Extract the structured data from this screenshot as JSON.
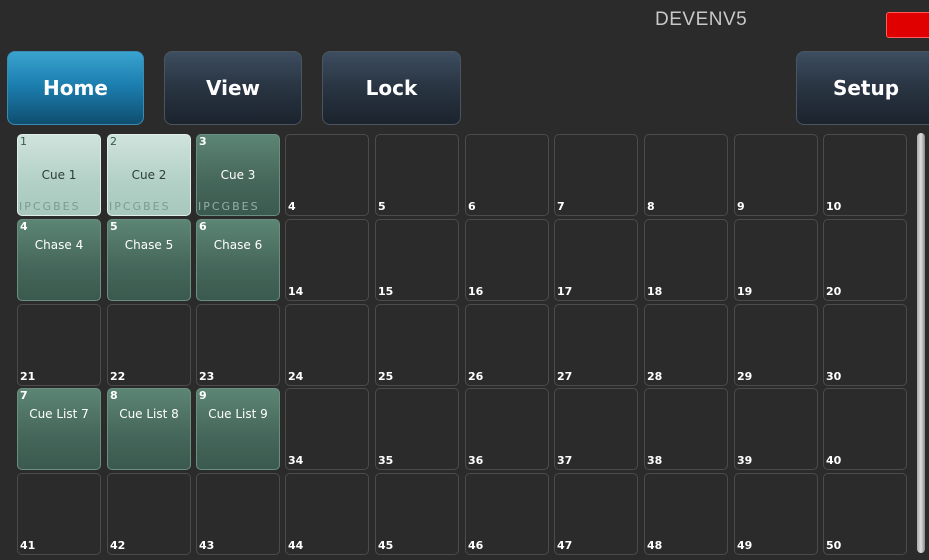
{
  "header": {
    "device_name": "DEVENV5",
    "status_color": "#e00000"
  },
  "nav": {
    "home": "Home",
    "view": "View",
    "lock": "Lock",
    "setup": "Setup"
  },
  "colors": {
    "active_button": "#1c7fb0",
    "cue_selected": "#b2d0c6",
    "cue": "#45665a"
  },
  "playbacks": [
    {
      "num": "1",
      "label": "Cue 1",
      "selected": true,
      "flags": "IPCGBES"
    },
    {
      "num": "2",
      "label": "Cue 2",
      "selected": true,
      "flags": "IPCGBES"
    },
    {
      "num": "3",
      "label": "Cue 3",
      "selected": false,
      "flags": "IPCGBES"
    },
    {
      "num": "4"
    },
    {
      "num": "5"
    },
    {
      "num": "6"
    },
    {
      "num": "7"
    },
    {
      "num": "8"
    },
    {
      "num": "9"
    },
    {
      "num": "10"
    },
    {
      "num": "4",
      "label": "Chase 4"
    },
    {
      "num": "5",
      "label": "Chase 5"
    },
    {
      "num": "6",
      "label": "Chase 6"
    },
    {
      "num": "14"
    },
    {
      "num": "15"
    },
    {
      "num": "16"
    },
    {
      "num": "17"
    },
    {
      "num": "18"
    },
    {
      "num": "19"
    },
    {
      "num": "20"
    },
    {
      "num": "21"
    },
    {
      "num": "22"
    },
    {
      "num": "23"
    },
    {
      "num": "24"
    },
    {
      "num": "25"
    },
    {
      "num": "26"
    },
    {
      "num": "27"
    },
    {
      "num": "28"
    },
    {
      "num": "29"
    },
    {
      "num": "30"
    },
    {
      "num": "7",
      "label": "Cue List 7"
    },
    {
      "num": "8",
      "label": "Cue List 8"
    },
    {
      "num": "9",
      "label": "Cue List 9"
    },
    {
      "num": "34"
    },
    {
      "num": "35"
    },
    {
      "num": "36"
    },
    {
      "num": "37"
    },
    {
      "num": "38"
    },
    {
      "num": "39"
    },
    {
      "num": "40"
    },
    {
      "num": "41"
    },
    {
      "num": "42"
    },
    {
      "num": "43"
    },
    {
      "num": "44"
    },
    {
      "num": "45"
    },
    {
      "num": "46"
    },
    {
      "num": "47"
    },
    {
      "num": "48"
    },
    {
      "num": "49"
    },
    {
      "num": "50"
    }
  ]
}
